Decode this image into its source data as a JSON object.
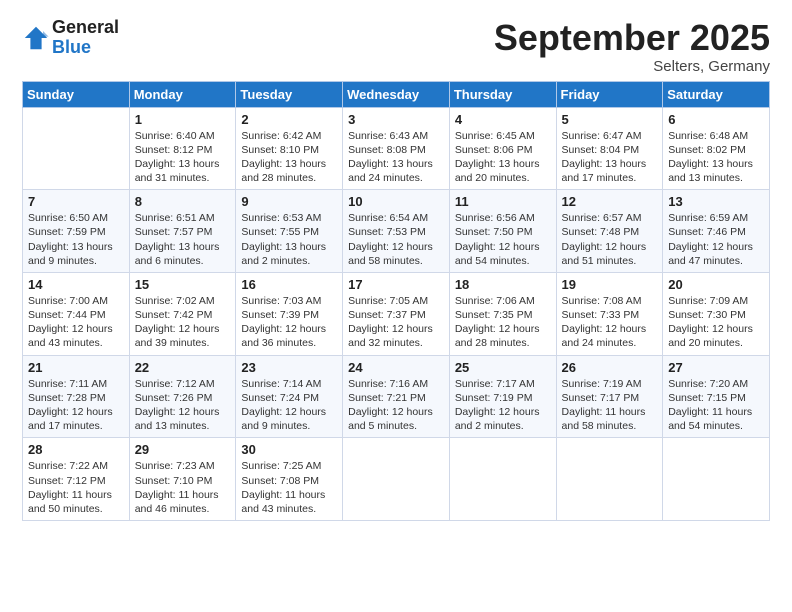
{
  "logo": {
    "general": "General",
    "blue": "Blue"
  },
  "title": "September 2025",
  "location": "Selters, Germany",
  "days_header": [
    "Sunday",
    "Monday",
    "Tuesday",
    "Wednesday",
    "Thursday",
    "Friday",
    "Saturday"
  ],
  "weeks": [
    [
      {
        "day": "",
        "sunrise": "",
        "sunset": "",
        "daylight": ""
      },
      {
        "day": "1",
        "sunrise": "Sunrise: 6:40 AM",
        "sunset": "Sunset: 8:12 PM",
        "daylight": "Daylight: 13 hours and 31 minutes."
      },
      {
        "day": "2",
        "sunrise": "Sunrise: 6:42 AM",
        "sunset": "Sunset: 8:10 PM",
        "daylight": "Daylight: 13 hours and 28 minutes."
      },
      {
        "day": "3",
        "sunrise": "Sunrise: 6:43 AM",
        "sunset": "Sunset: 8:08 PM",
        "daylight": "Daylight: 13 hours and 24 minutes."
      },
      {
        "day": "4",
        "sunrise": "Sunrise: 6:45 AM",
        "sunset": "Sunset: 8:06 PM",
        "daylight": "Daylight: 13 hours and 20 minutes."
      },
      {
        "day": "5",
        "sunrise": "Sunrise: 6:47 AM",
        "sunset": "Sunset: 8:04 PM",
        "daylight": "Daylight: 13 hours and 17 minutes."
      },
      {
        "day": "6",
        "sunrise": "Sunrise: 6:48 AM",
        "sunset": "Sunset: 8:02 PM",
        "daylight": "Daylight: 13 hours and 13 minutes."
      }
    ],
    [
      {
        "day": "7",
        "sunrise": "Sunrise: 6:50 AM",
        "sunset": "Sunset: 7:59 PM",
        "daylight": "Daylight: 13 hours and 9 minutes."
      },
      {
        "day": "8",
        "sunrise": "Sunrise: 6:51 AM",
        "sunset": "Sunset: 7:57 PM",
        "daylight": "Daylight: 13 hours and 6 minutes."
      },
      {
        "day": "9",
        "sunrise": "Sunrise: 6:53 AM",
        "sunset": "Sunset: 7:55 PM",
        "daylight": "Daylight: 13 hours and 2 minutes."
      },
      {
        "day": "10",
        "sunrise": "Sunrise: 6:54 AM",
        "sunset": "Sunset: 7:53 PM",
        "daylight": "Daylight: 12 hours and 58 minutes."
      },
      {
        "day": "11",
        "sunrise": "Sunrise: 6:56 AM",
        "sunset": "Sunset: 7:50 PM",
        "daylight": "Daylight: 12 hours and 54 minutes."
      },
      {
        "day": "12",
        "sunrise": "Sunrise: 6:57 AM",
        "sunset": "Sunset: 7:48 PM",
        "daylight": "Daylight: 12 hours and 51 minutes."
      },
      {
        "day": "13",
        "sunrise": "Sunrise: 6:59 AM",
        "sunset": "Sunset: 7:46 PM",
        "daylight": "Daylight: 12 hours and 47 minutes."
      }
    ],
    [
      {
        "day": "14",
        "sunrise": "Sunrise: 7:00 AM",
        "sunset": "Sunset: 7:44 PM",
        "daylight": "Daylight: 12 hours and 43 minutes."
      },
      {
        "day": "15",
        "sunrise": "Sunrise: 7:02 AM",
        "sunset": "Sunset: 7:42 PM",
        "daylight": "Daylight: 12 hours and 39 minutes."
      },
      {
        "day": "16",
        "sunrise": "Sunrise: 7:03 AM",
        "sunset": "Sunset: 7:39 PM",
        "daylight": "Daylight: 12 hours and 36 minutes."
      },
      {
        "day": "17",
        "sunrise": "Sunrise: 7:05 AM",
        "sunset": "Sunset: 7:37 PM",
        "daylight": "Daylight: 12 hours and 32 minutes."
      },
      {
        "day": "18",
        "sunrise": "Sunrise: 7:06 AM",
        "sunset": "Sunset: 7:35 PM",
        "daylight": "Daylight: 12 hours and 28 minutes."
      },
      {
        "day": "19",
        "sunrise": "Sunrise: 7:08 AM",
        "sunset": "Sunset: 7:33 PM",
        "daylight": "Daylight: 12 hours and 24 minutes."
      },
      {
        "day": "20",
        "sunrise": "Sunrise: 7:09 AM",
        "sunset": "Sunset: 7:30 PM",
        "daylight": "Daylight: 12 hours and 20 minutes."
      }
    ],
    [
      {
        "day": "21",
        "sunrise": "Sunrise: 7:11 AM",
        "sunset": "Sunset: 7:28 PM",
        "daylight": "Daylight: 12 hours and 17 minutes."
      },
      {
        "day": "22",
        "sunrise": "Sunrise: 7:12 AM",
        "sunset": "Sunset: 7:26 PM",
        "daylight": "Daylight: 12 hours and 13 minutes."
      },
      {
        "day": "23",
        "sunrise": "Sunrise: 7:14 AM",
        "sunset": "Sunset: 7:24 PM",
        "daylight": "Daylight: 12 hours and 9 minutes."
      },
      {
        "day": "24",
        "sunrise": "Sunrise: 7:16 AM",
        "sunset": "Sunset: 7:21 PM",
        "daylight": "Daylight: 12 hours and 5 minutes."
      },
      {
        "day": "25",
        "sunrise": "Sunrise: 7:17 AM",
        "sunset": "Sunset: 7:19 PM",
        "daylight": "Daylight: 12 hours and 2 minutes."
      },
      {
        "day": "26",
        "sunrise": "Sunrise: 7:19 AM",
        "sunset": "Sunset: 7:17 PM",
        "daylight": "Daylight: 11 hours and 58 minutes."
      },
      {
        "day": "27",
        "sunrise": "Sunrise: 7:20 AM",
        "sunset": "Sunset: 7:15 PM",
        "daylight": "Daylight: 11 hours and 54 minutes."
      }
    ],
    [
      {
        "day": "28",
        "sunrise": "Sunrise: 7:22 AM",
        "sunset": "Sunset: 7:12 PM",
        "daylight": "Daylight: 11 hours and 50 minutes."
      },
      {
        "day": "29",
        "sunrise": "Sunrise: 7:23 AM",
        "sunset": "Sunset: 7:10 PM",
        "daylight": "Daylight: 11 hours and 46 minutes."
      },
      {
        "day": "30",
        "sunrise": "Sunrise: 7:25 AM",
        "sunset": "Sunset: 7:08 PM",
        "daylight": "Daylight: 11 hours and 43 minutes."
      },
      {
        "day": "",
        "sunrise": "",
        "sunset": "",
        "daylight": ""
      },
      {
        "day": "",
        "sunrise": "",
        "sunset": "",
        "daylight": ""
      },
      {
        "day": "",
        "sunrise": "",
        "sunset": "",
        "daylight": ""
      },
      {
        "day": "",
        "sunrise": "",
        "sunset": "",
        "daylight": ""
      }
    ]
  ]
}
